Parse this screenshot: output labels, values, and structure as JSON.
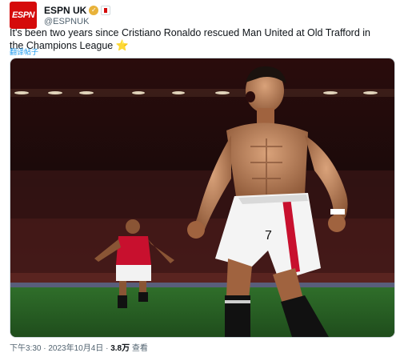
{
  "author": {
    "avatar_text": "ESPN",
    "display_name": "ESPN UK",
    "handle": "@ESPNUK"
  },
  "tweet": {
    "text": "It's been two years since Cristiano Ronaldo rescued Man United at Old Trafford in the Champions League",
    "emoji": "⭐",
    "translate_label": "翻译帖子"
  },
  "media": {
    "jersey_number": "7"
  },
  "meta": {
    "time": "下午3:30",
    "separator": "·",
    "date": "2023年10月4日",
    "views_count": "3.8万",
    "views_label": "查看"
  }
}
